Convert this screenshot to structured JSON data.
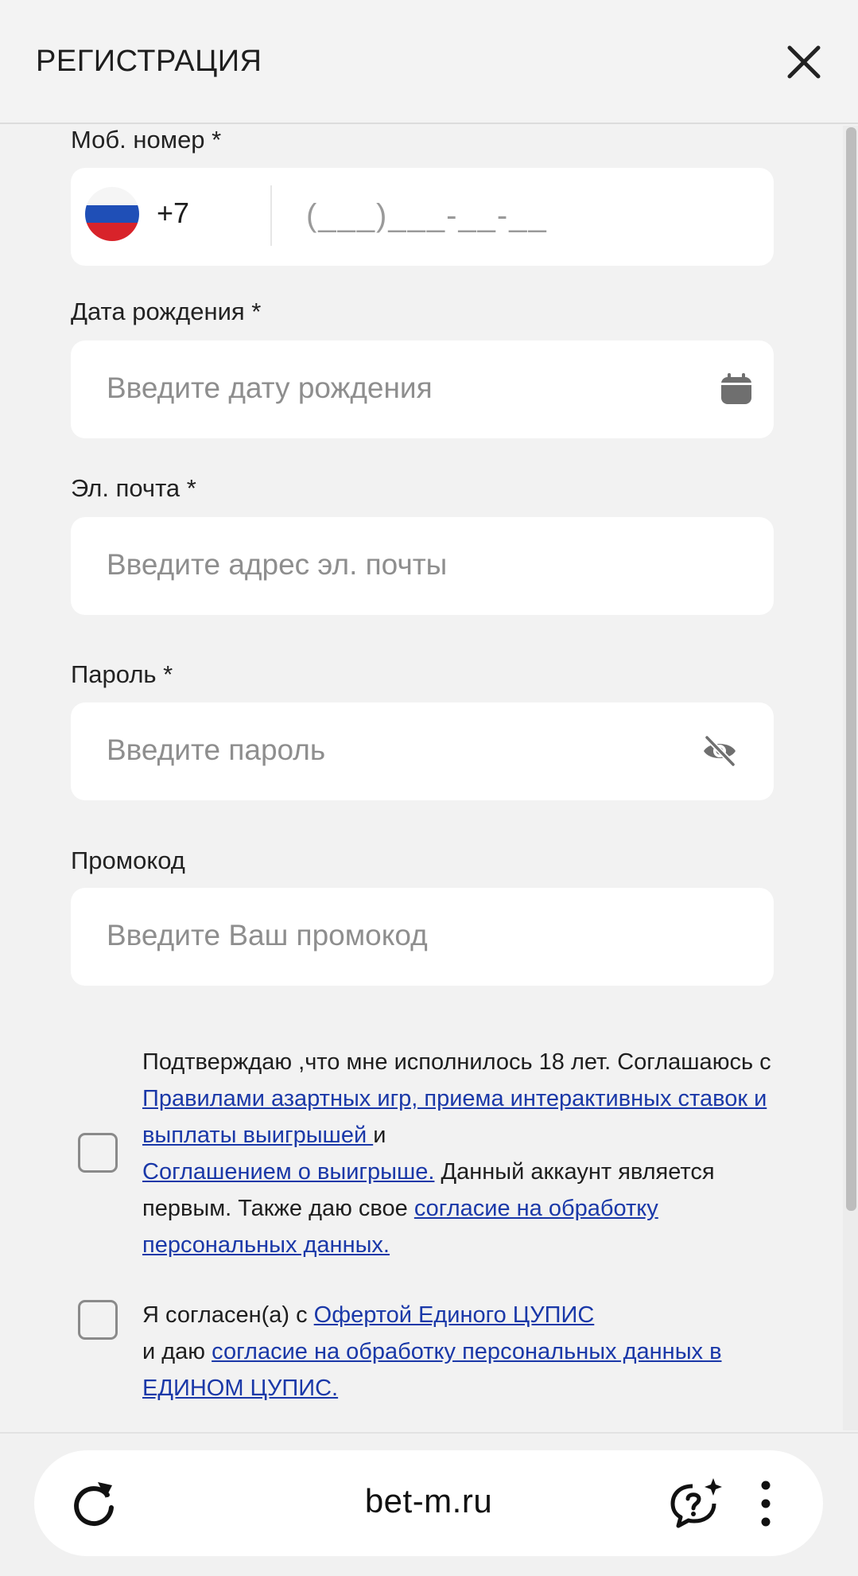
{
  "header": {
    "title": "РЕГИСТРАЦИЯ",
    "close_icon": "close-icon"
  },
  "form": {
    "phone": {
      "label": "Моб. номер *",
      "country_code": "+7",
      "placeholder": "(___)___-__-__",
      "flag_icon": "russia-flag-icon"
    },
    "birthdate": {
      "label": "Дата рождения *",
      "placeholder": "Введите дату рождения",
      "icon": "calendar-icon"
    },
    "email": {
      "label": "Эл. почта *",
      "placeholder": "Введите адрес эл. почты"
    },
    "password": {
      "label": "Пароль *",
      "placeholder": "Введите пароль",
      "icon": "eye-off-icon"
    },
    "promo": {
      "label": "Промокод",
      "placeholder": "Введите Ваш промокод"
    }
  },
  "consent1": {
    "checked": false,
    "t1": "Подтверждаю ,что мне исполнилось 18 лет. Соглашаюсь с ",
    "link1": "Правилами азартных игр, приема интерактивных ставок и выплаты выигрышей ",
    "t2": "и ",
    "link2": "Соглашением о выигрыше.",
    "t3": " Данный аккаунт является первым. Также даю свое ",
    "link3": "согласие на обработку персональных данных."
  },
  "consent2": {
    "checked": false,
    "t1": "Я согласен(а) с ",
    "link1": "Офертой Единого ЦУПИС",
    "t2": "и даю ",
    "link2": "согласие на обработку персональных данных в ЕДИНОМ ЦУПИС."
  },
  "browser": {
    "url": "bet-m.ru",
    "reload_icon": "reload-icon",
    "assistant_icon": "ai-assistant-icon",
    "menu_icon": "more-vertical-icon"
  },
  "colors": {
    "background": "#f2f2f2",
    "field": "#ffffff",
    "link": "#1a38a8",
    "placeholder": "#8e8e8e"
  }
}
